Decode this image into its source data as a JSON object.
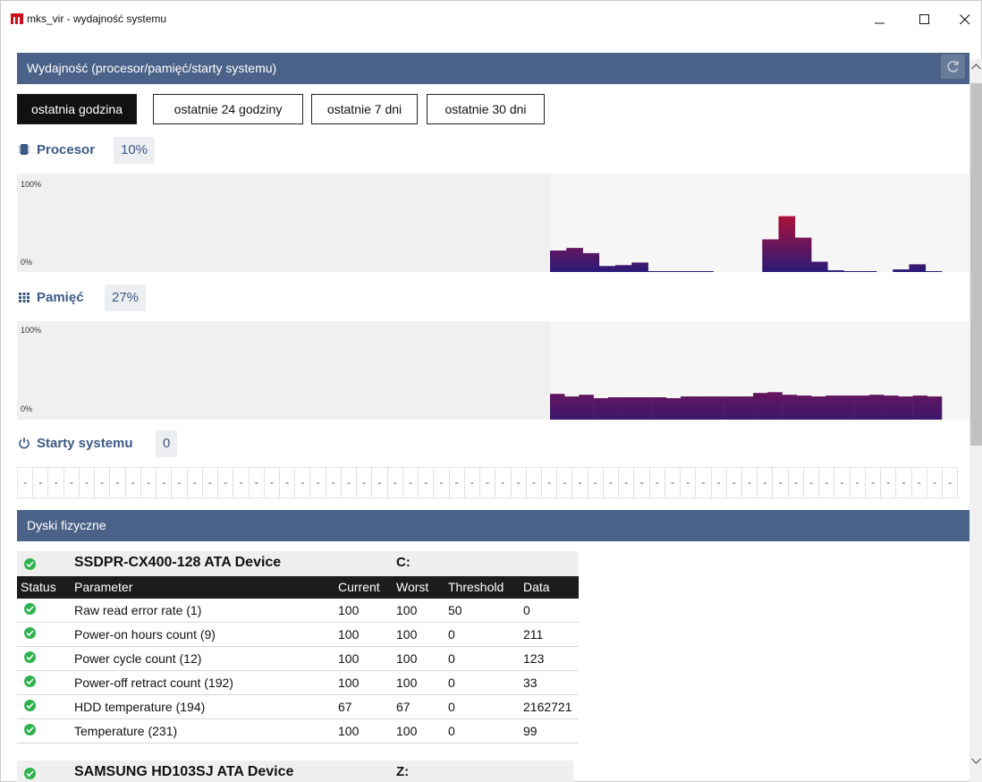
{
  "window": {
    "title": "mks_vir - wydajność systemu"
  },
  "performance": {
    "header": "Wydajność (procesor/pamięć/starty systemu)",
    "ranges": [
      "ostatnia godzina",
      "ostatnie 24 godziny",
      "ostatnie 7 dni",
      "ostatnie 30 dni"
    ],
    "active_range": "ostatnia godzina",
    "cpu": {
      "label": "Procesor",
      "value": "10%",
      "axis_max": "100%",
      "axis_min": "0%"
    },
    "memory": {
      "label": "Pamięć",
      "value": "27%",
      "axis_max": "100%",
      "axis_min": "0%"
    },
    "boots": {
      "label": "Starty systemu",
      "value": "0",
      "placeholder": "-"
    }
  },
  "chart_data": [
    {
      "type": "bar",
      "title": "Procesor",
      "ylim": [
        0,
        100
      ],
      "values": [
        25,
        28,
        22,
        7,
        8,
        11,
        1,
        1,
        1,
        1,
        0,
        0,
        0,
        38,
        65,
        40,
        12,
        2,
        1,
        1,
        0,
        3,
        9,
        1
      ],
      "color_low": "#2a1a78",
      "color_high": "#c8102e"
    },
    {
      "type": "bar",
      "title": "Pamięć",
      "ylim": [
        0,
        100
      ],
      "values": [
        30,
        27,
        29,
        25,
        26,
        26,
        26,
        26,
        25,
        27,
        27,
        27,
        27,
        27,
        31,
        32,
        29,
        28,
        27,
        28,
        28,
        28,
        29,
        28,
        27,
        28,
        27
      ],
      "color_low": "#3d176b",
      "color_high": "#a0124a"
    }
  ],
  "disks": {
    "header": "Dyski fizyczne",
    "columns": [
      "Status",
      "Parameter",
      "Current",
      "Worst",
      "Threshold",
      "Data"
    ],
    "items": [
      {
        "name": "SSDPR-CX400-128 ATA Device",
        "drive": "C:",
        "rows": [
          {
            "param": "Raw read error rate (1)",
            "current": "100",
            "worst": "100",
            "threshold": "50",
            "data": "0"
          },
          {
            "param": "Power-on hours count (9)",
            "current": "100",
            "worst": "100",
            "threshold": "0",
            "data": "211"
          },
          {
            "param": "Power cycle count (12)",
            "current": "100",
            "worst": "100",
            "threshold": "0",
            "data": "123"
          },
          {
            "param": "Power-off retract count (192)",
            "current": "100",
            "worst": "100",
            "threshold": "0",
            "data": "33"
          },
          {
            "param": "HDD temperature (194)",
            "current": "67",
            "worst": "67",
            "threshold": "0",
            "data": "2162721"
          },
          {
            "param": "Temperature (231)",
            "current": "100",
            "worst": "100",
            "threshold": "0",
            "data": "99"
          }
        ]
      },
      {
        "name": "SAMSUNG HD103SJ ATA Device",
        "drive": "Z:",
        "rows": []
      }
    ]
  },
  "colors": {
    "accent": "#4b6288",
    "status_ok": "#2fb24e",
    "label": "#3c5a86"
  }
}
